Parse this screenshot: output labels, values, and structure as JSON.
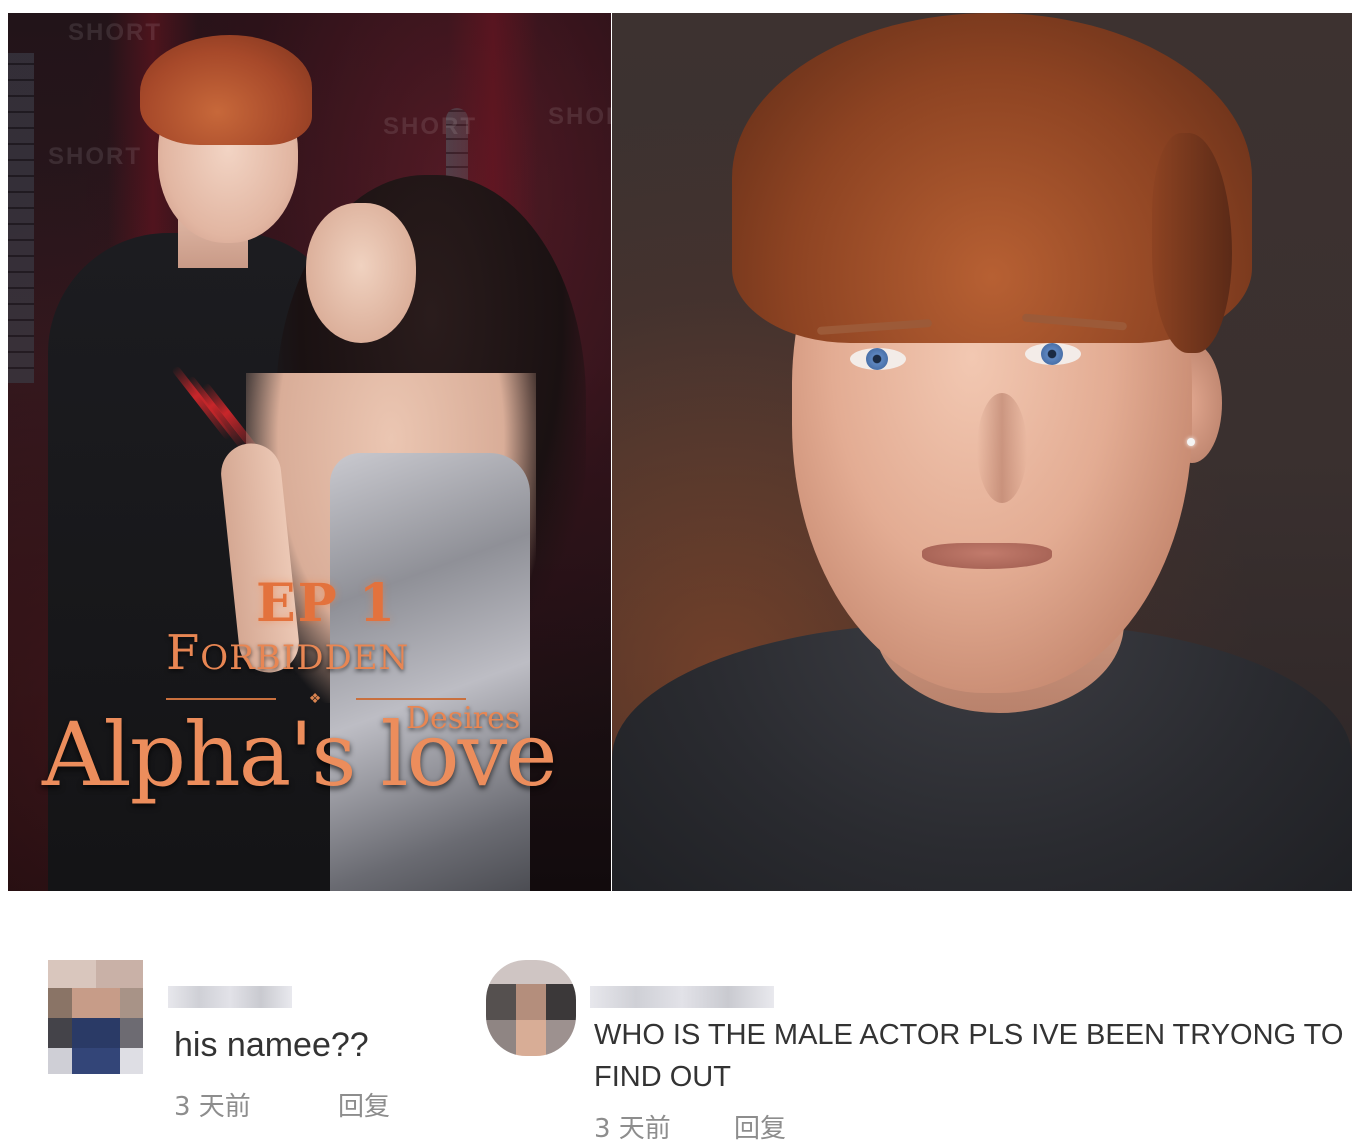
{
  "poster": {
    "episode": "EP 1",
    "title_line1": "Forbidden",
    "title_line2": "Desires",
    "title_line3": "Alpha's love",
    "watermark": "SHORT"
  },
  "comments": [
    {
      "text": "his namee??",
      "time": "3 天前",
      "reply_label": "回复"
    },
    {
      "text": "WHO IS THE MALE ACTOR PLS IVE BEEN TRYONG TO FIND OUT",
      "time": "3 天前",
      "reply_label": "回复"
    }
  ],
  "colors": {
    "title_orange": "#e88653",
    "comment_text": "#333333",
    "meta_text": "#8d8d8d"
  }
}
